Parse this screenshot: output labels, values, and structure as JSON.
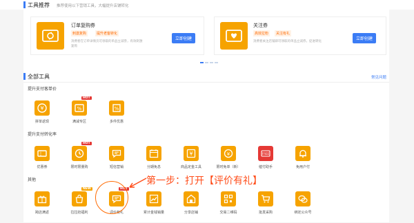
{
  "tools_recommend": {
    "title": "工具推荐",
    "desc": "推荐使用以下营销工具，大幅提升店铺转化"
  },
  "cards": [
    {
      "title": "订单复购券",
      "tags": [
        "刺激复购",
        "提升老客转化"
      ],
      "desc": "消费者在订单详情页可领取的单品立减券，有效刺激",
      "desc2": "复购",
      "button": "立即创建",
      "icon": "coupon-cycle-icon"
    },
    {
      "title": "关注券",
      "tags": [
        "高效拉粉",
        "关注有礼"
      ],
      "desc": "消费者关注店铺即可领取的单品立减券，促进转化",
      "desc2": "",
      "button": "立即创建",
      "icon": "coupon-heart-icon"
    }
  ],
  "all_tools": {
    "title": "全部工具",
    "help": "常见问题"
  },
  "groups": [
    {
      "label": "提升支付客单价",
      "tools": [
        {
          "label": "拼单返现",
          "badge": "",
          "icon": "yen-coin-icon"
        },
        {
          "label": "满减专区",
          "badge": "HOT",
          "icon": "percent-tag-icon"
        },
        {
          "label": "多件优惠",
          "badge": "",
          "icon": "percent-box-icon"
        }
      ]
    },
    {
      "label": "提升支付转化率",
      "tools": [
        {
          "label": "优惠券",
          "badge": "",
          "icon": "ticket-icon"
        },
        {
          "label": "限时限量购",
          "badge": "HOT",
          "icon": "clock-icon"
        },
        {
          "label": "短信营销",
          "badge": "",
          "icon": "message-icon"
        },
        {
          "label": "分期免息",
          "badge": "",
          "icon": "calendar-icon"
        },
        {
          "label": "商品定金工具",
          "badge": "",
          "icon": "yen-box-icon"
        },
        {
          "label": "限时免单（新）",
          "badge": "",
          "icon": "yen-clock-icon"
        },
        {
          "label": "催付助手",
          "badge": "",
          "icon": "free-icon"
        },
        {
          "label": "免用户付",
          "badge": "",
          "icon": "bell-icon"
        }
      ]
    },
    {
      "label": "其他",
      "tools": [
        {
          "label": "跨店满返",
          "badge": "",
          "icon": "gift-icon"
        },
        {
          "label": "拉拉抢福利",
          "badge": "NEW",
          "icon": "gift-bag-icon"
        },
        {
          "label": "评价有礼",
          "badge": "HOT",
          "icon": "comment-icon"
        },
        {
          "label": "累计金钱销量",
          "badge": "",
          "icon": "chart-icon"
        },
        {
          "label": "分享店铺",
          "badge": "",
          "icon": "store-icon"
        },
        {
          "label": "交易二维码",
          "badge": "",
          "icon": "qrcode-icon"
        },
        {
          "label": "批发采购",
          "badge": "",
          "icon": "cart-icon"
        },
        {
          "label": "绑定公众号",
          "badge": "",
          "icon": "wechat-icon"
        }
      ]
    }
  ],
  "annotation": "第一步：打开【评价有礼】",
  "colors": {
    "accent": "#3b7cf5",
    "tool_orange": "#f6a300",
    "annotation": "#ff4d1a",
    "hot": "#e53935"
  }
}
